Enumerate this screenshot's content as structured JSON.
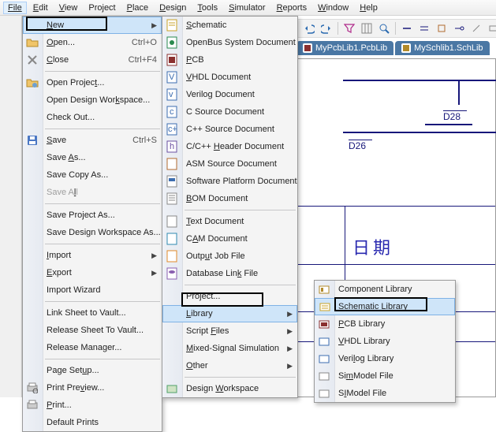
{
  "menubar": {
    "file": "File",
    "edit": "Edit",
    "view": "View",
    "project": "Project",
    "place": "Place",
    "design": "Design",
    "tools": "Tools",
    "simulator": "Simulator",
    "reports": "Reports",
    "window": "Window",
    "help": "Help"
  },
  "file_menu": {
    "new": "New",
    "open": "Open...",
    "open_acc": "Ctrl+O",
    "close": "Close",
    "close_acc": "Ctrl+F4",
    "open_project": "Open Project...",
    "open_workspace": "Open Design Workspace...",
    "check_out": "Check Out...",
    "save": "Save",
    "save_acc": "Ctrl+S",
    "save_as": "Save As...",
    "save_copy": "Save Copy As...",
    "save_all": "Save All",
    "save_project_as": "Save Project As...",
    "save_workspace_as": "Save Design Workspace As...",
    "import": "Import",
    "export": "Export",
    "import_wizard": "Import Wizard",
    "link_vault": "Link Sheet to Vault...",
    "release_vault": "Release Sheet To Vault...",
    "release_mgr": "Release Manager...",
    "page_setup": "Page Setup...",
    "print_preview": "Print Preview...",
    "print": "Print...",
    "default_prints": "Default Prints"
  },
  "new_menu": {
    "schematic": "Schematic",
    "openbus": "OpenBus System Document",
    "pcb": "PCB",
    "vhdl": "VHDL Document",
    "verilog": "Verilog Document",
    "csrc": "C Source Document",
    "cppsrc": "C++ Source Document",
    "cpphdr": "C/C++ Header Document",
    "asm": "ASM Source Document",
    "platform": "Software Platform Document",
    "bom": "BOM Document",
    "text": "Text Document",
    "cam": "CAM Document",
    "outjob": "Output Job File",
    "dblink": "Database Link File",
    "project": "Project...",
    "library": "Library",
    "script": "Script Files",
    "mixed": "Mixed-Signal Simulation",
    "other": "Other",
    "workspace": "Design Workspace"
  },
  "lib_menu": {
    "component": "Component Library",
    "schematic": "Schematic Library",
    "pcb": "PCB Library",
    "vhdl": "VHDL Library",
    "verilog": "Verilog Library",
    "simmodel": "SimModel File",
    "simodel": "SIModel File"
  },
  "tabs": {
    "a": "MyPcbLib1.PcbLib",
    "b": "MySchlib1.SchLib"
  },
  "canvas": {
    "d26": "D26",
    "d28": "D28",
    "cjk": "日期"
  },
  "icons": {
    "doc": "#d9a13a",
    "pcb": "#8a2f2f",
    "c": "#3c6db0",
    "h": "#6a4fa0",
    "asm": "#b06a2f",
    "txt": "#888",
    "cam": "#2f8ab0",
    "out": "#e08a2a",
    "db": "#8a5fb0",
    "lib": "#b28a2a",
    "sch": "#c9a227",
    "open": "#d9a13a",
    "close": "#888",
    "print": "#555",
    "ws": "#4fa06a"
  }
}
